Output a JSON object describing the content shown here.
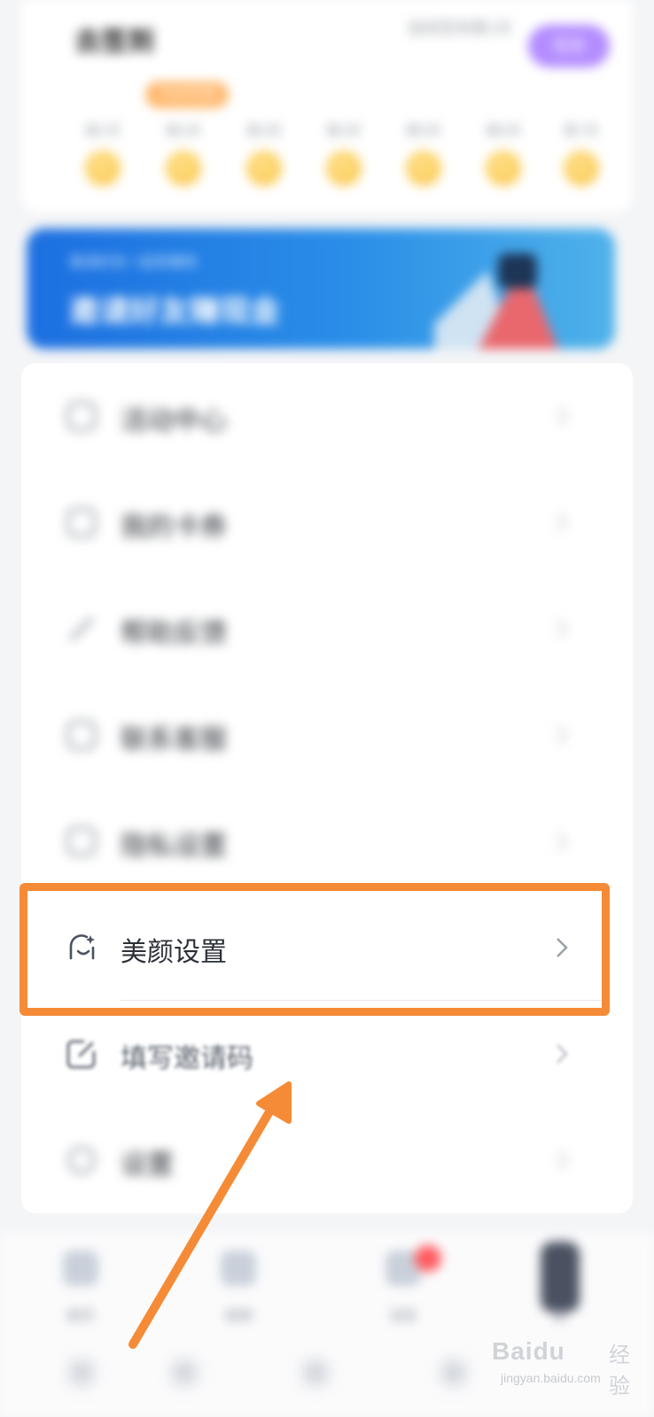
{
  "header": {
    "title": "去签到",
    "right_text": "连续签到第1天",
    "pill_label": "签到",
    "badge": "今日可领"
  },
  "checkin_days": [
    {
      "label": "第1天"
    },
    {
      "label": "第2天"
    },
    {
      "label": "第3天"
    },
    {
      "label": "第4天"
    },
    {
      "label": "第5天"
    },
    {
      "label": "第6天"
    },
    {
      "label": "第7天"
    }
  ],
  "banner": {
    "subtitle": "邀请好友一起来赚钱",
    "title": "邀请好友赚现金"
  },
  "menu": {
    "items": [
      {
        "label": "活动中心",
        "icon": "gift-icon"
      },
      {
        "label": "我的卡券",
        "icon": "coupon-icon"
      },
      {
        "label": "帮助反馈",
        "icon": "edit-icon"
      },
      {
        "label": "联系客服",
        "icon": "service-icon"
      },
      {
        "label": "隐私设置",
        "icon": "shield-icon"
      },
      {
        "label": "美颜设置",
        "icon": "beauty-face-icon"
      },
      {
        "label": "填写邀请码",
        "icon": "pencil-square-icon"
      },
      {
        "label": "设置",
        "icon": "settings-icon"
      }
    ]
  },
  "bottom_nav": {
    "items": [
      {
        "label": "首页"
      },
      {
        "label": "视频"
      },
      {
        "label": "消息"
      },
      {
        "label": "我"
      }
    ]
  },
  "watermark": {
    "brand": "Bai",
    "brand2": "du",
    "cn": "经验",
    "url": "jingyan.baidu.com"
  },
  "colors": {
    "highlight": "#f58b36",
    "accent": "#b38cff",
    "banner": "#1c6fe0"
  }
}
